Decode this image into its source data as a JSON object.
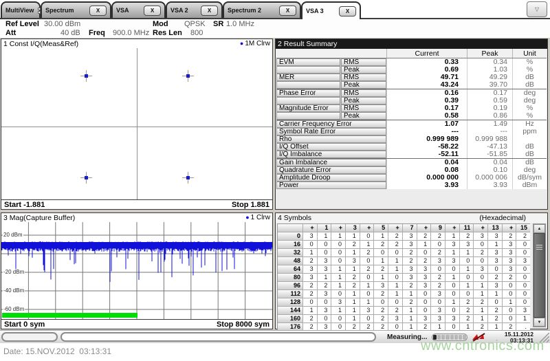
{
  "tab_bar": {
    "close_label": "X",
    "tabs": [
      {
        "label": "MultiView",
        "closable": false,
        "grid_icon": true,
        "active": false
      },
      {
        "label": "Spectrum",
        "closable": true,
        "active": false
      },
      {
        "label": "VSA",
        "closable": true,
        "active": false
      },
      {
        "label": "VSA 2",
        "closable": true,
        "active": false
      },
      {
        "label": "Spectrum 2",
        "closable": true,
        "active": false
      },
      {
        "label": "VSA 3",
        "closable": true,
        "active": true
      }
    ]
  },
  "settings": {
    "ref_level_label": "Ref Level",
    "ref_level_value": "30.00 dBm",
    "att_label": "Att",
    "att_value": "40 dB",
    "freq_label": "Freq",
    "freq_value": "900.0 MHz",
    "mod_label": "Mod",
    "mod_value": "QPSK",
    "res_len_label": "Res Len",
    "res_len_value": "800",
    "sr_label": "SR",
    "sr_value": "1.0 MHz"
  },
  "const_panel": {
    "title": "1 Const I/Q(Meas&Ref)",
    "trace_dot": "●",
    "trace_label": "1M Clrw",
    "start": "Start -1.881",
    "stop": "Stop 1.881",
    "axis_max": 1.881,
    "points": [
      {
        "i": -0.707,
        "q": 0.707
      },
      {
        "i": 0.707,
        "q": 0.707
      },
      {
        "i": -0.707,
        "q": -0.707
      },
      {
        "i": 0.707,
        "q": -0.707
      }
    ]
  },
  "result_panel": {
    "title": "2 Result Summary",
    "columns": [
      "Current",
      "Peak",
      "Unit"
    ],
    "rows": [
      {
        "name": "EVM",
        "sub": "RMS",
        "current": "0.33",
        "peak": "0.34",
        "unit": "%"
      },
      {
        "name": "",
        "sub": "Peak",
        "current": "0.69",
        "peak": "1.03",
        "unit": "%"
      },
      {
        "name": "MER",
        "sub": "RMS",
        "current": "49.71",
        "peak": "49.29",
        "unit": "dB"
      },
      {
        "name": "",
        "sub": "Peak",
        "current": "43.24",
        "peak": "39.70",
        "unit": "dB"
      },
      {
        "name": "Phase Error",
        "sub": "RMS",
        "current": "0.16",
        "peak": "0.17",
        "unit": "deg",
        "group_start": true
      },
      {
        "name": "",
        "sub": "Peak",
        "current": "0.39",
        "peak": "0.59",
        "unit": "deg"
      },
      {
        "name": "Magnitude Error",
        "sub": "RMS",
        "current": "0.17",
        "peak": "0.19",
        "unit": "%"
      },
      {
        "name": "",
        "sub": "Peak",
        "current": "0.58",
        "peak": "0.86",
        "unit": "%"
      },
      {
        "name": "Carrier Frequency Error",
        "sub": "",
        "current": "1.07",
        "peak": "1.49",
        "unit": "Hz",
        "group_start": true
      },
      {
        "name": "Symbol Rate Error",
        "sub": "",
        "current": "---",
        "peak": "---",
        "unit": "ppm"
      },
      {
        "name": "Rho",
        "sub": "",
        "current": "0.999 989",
        "peak": "0.999 988",
        "unit": ""
      },
      {
        "name": "I/Q Offset",
        "sub": "",
        "current": "-58.22",
        "peak": "-47.13",
        "unit": "dB"
      },
      {
        "name": "I/Q Imbalance",
        "sub": "",
        "current": "-52.11",
        "peak": "-51.85",
        "unit": "dB"
      },
      {
        "name": "Gain Imbalance",
        "sub": "",
        "current": "0.04",
        "peak": "0.04",
        "unit": "dB",
        "group_start": true
      },
      {
        "name": "Quadrature Error",
        "sub": "",
        "current": "0.08",
        "peak": "0.10",
        "unit": "deg"
      },
      {
        "name": "Amplitude Droop",
        "sub": "",
        "current": "0.000 000",
        "peak": "0.000 006",
        "unit": "dB/sym"
      },
      {
        "name": "Power",
        "sub": "",
        "current": "3.93",
        "peak": "3.93",
        "unit": "dBm"
      }
    ]
  },
  "mag_panel": {
    "title": "3 Mag(Capture Buffer)",
    "trace_dot": "●",
    "trace_label": "1 Clrw",
    "start": "Start 0 sym",
    "stop": "Stop 8000 sym",
    "grid_dbm": [
      20,
      0,
      -20,
      -40,
      -60
    ],
    "y_ticks": [
      {
        "label": "20 dBm",
        "dbm": 20
      },
      {
        "label": "-20 dBm",
        "dbm": -20
      },
      {
        "label": "-40 dBm",
        "dbm": -40
      },
      {
        "label": "-60 dBm",
        "dbm": -60
      }
    ],
    "trace_color": "#1010d8",
    "analysis_bar": {
      "color": "#00dd04",
      "fraction": 0.5
    }
  },
  "symbols_panel": {
    "title": "4 Symbols",
    "subtitle": "(Hexadecimal)",
    "col_headers": [
      "+",
      "1",
      "+",
      "3",
      "+",
      "5",
      "+",
      "7",
      "+",
      "9",
      "+",
      "11",
      "+",
      "13",
      "+",
      "15"
    ],
    "rows": [
      {
        "index": "0",
        "values": [
          "3",
          "1",
          "1",
          "1",
          "0",
          "1",
          "2",
          "3",
          "2",
          "2",
          "1",
          "2",
          "3",
          "3",
          "2",
          "2"
        ]
      },
      {
        "index": "16",
        "values": [
          "0",
          "0",
          "0",
          "2",
          "1",
          "2",
          "2",
          "3",
          "1",
          "0",
          "3",
          "3",
          "0",
          "1",
          "3",
          "0"
        ]
      },
      {
        "index": "32",
        "values": [
          "1",
          "0",
          "0",
          "1",
          "2",
          "0",
          "0",
          "2",
          "0",
          "2",
          "1",
          "1",
          "2",
          "3",
          "3",
          "0"
        ]
      },
      {
        "index": "48",
        "values": [
          "2",
          "3",
          "0",
          "3",
          "0",
          "1",
          "1",
          "2",
          "2",
          "3",
          "3",
          "0",
          "0",
          "3",
          "3",
          "3"
        ]
      },
      {
        "index": "64",
        "values": [
          "3",
          "3",
          "1",
          "1",
          "2",
          "2",
          "1",
          "3",
          "3",
          "0",
          "0",
          "1",
          "3",
          "0",
          "3",
          "0"
        ]
      },
      {
        "index": "80",
        "values": [
          "3",
          "1",
          "1",
          "2",
          "0",
          "1",
          "0",
          "3",
          "3",
          "2",
          "1",
          "0",
          "0",
          "2",
          "2",
          "0"
        ]
      },
      {
        "index": "96",
        "values": [
          "2",
          "2",
          "1",
          "2",
          "1",
          "3",
          "1",
          "2",
          "3",
          "2",
          "0",
          "1",
          "1",
          "3",
          "0",
          "0"
        ]
      },
      {
        "index": "112",
        "values": [
          "2",
          "3",
          "0",
          "1",
          "0",
          "2",
          "1",
          "1",
          "0",
          "3",
          "0",
          "0",
          "1",
          "1",
          "0",
          "0"
        ]
      },
      {
        "index": "128",
        "values": [
          "0",
          "0",
          "3",
          "1",
          "1",
          "0",
          "0",
          "2",
          "0",
          "0",
          "1",
          "2",
          "2",
          "0",
          "1",
          "0"
        ]
      },
      {
        "index": "144",
        "values": [
          "1",
          "3",
          "1",
          "1",
          "3",
          "2",
          "2",
          "1",
          "0",
          "3",
          "0",
          "2",
          "1",
          "2",
          "0",
          "3"
        ]
      },
      {
        "index": "160",
        "values": [
          "2",
          "0",
          "0",
          "1",
          "0",
          "2",
          "3",
          "1",
          "3",
          "3",
          "3",
          "2",
          "1",
          "2",
          "0",
          "1"
        ]
      },
      {
        "index": "176",
        "values": [
          "2",
          "3",
          "0",
          "2",
          "2",
          "2",
          "0",
          "1",
          "2",
          "1",
          "0",
          "1",
          "2",
          "1",
          "2",
          "."
        ]
      }
    ]
  },
  "status_bar": {
    "measuring": "Measuring...",
    "date": "15.11.2012",
    "time": "03:13:31"
  },
  "bottom": {
    "date_line": "Date: 15.NOV.2012  03:13:31",
    "watermark": "www.cntronics.com"
  },
  "colors": {
    "trace_blue": "#1010d8",
    "analysis_green": "#00dd04",
    "focused_header_bg": "#191919",
    "watermark_green": "#90c986"
  }
}
